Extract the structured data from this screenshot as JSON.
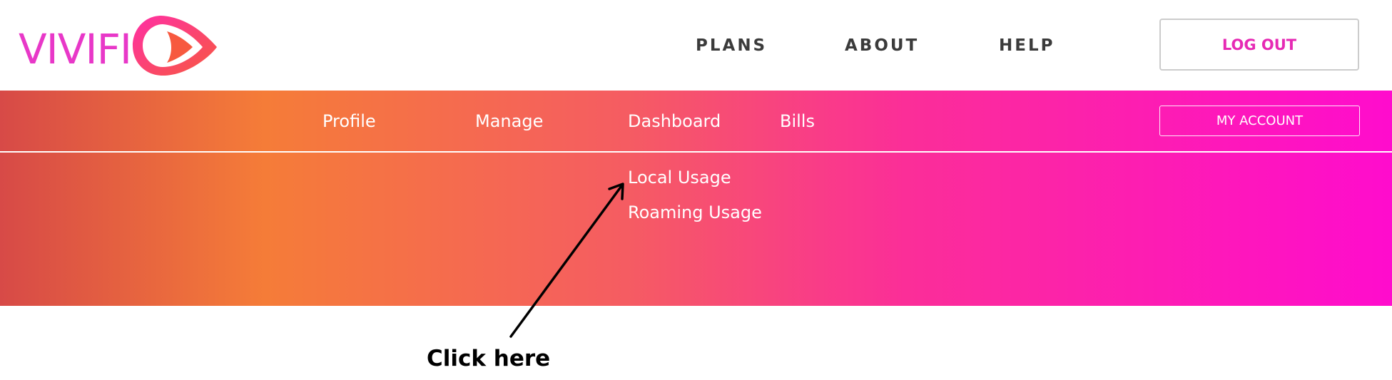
{
  "header": {
    "logo_text": "VIVIFI",
    "nav": [
      "PLANS",
      "ABOUT",
      "HELP"
    ],
    "logout_label": "LOG OUT"
  },
  "subnav": {
    "items": [
      "Profile",
      "Manage",
      "Dashboard",
      "Bills"
    ],
    "account_label": "MY ACCOUNT"
  },
  "dropdown": {
    "items": [
      "Local Usage",
      "Roaming Usage"
    ]
  },
  "annotation": {
    "text": "Click here"
  },
  "colors": {
    "brand_pink": "#e62ab4",
    "gradient_start": "#d74a47",
    "gradient_orange": "#f57c38",
    "gradient_end": "#ff0ccd"
  }
}
